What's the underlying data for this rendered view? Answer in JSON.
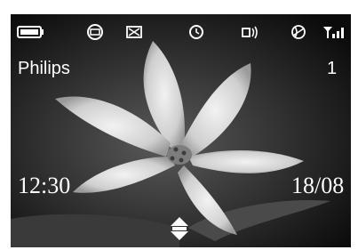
{
  "status_bar": {
    "icons": [
      "battery-icon",
      "message-icon",
      "missed-call-icon",
      "alarm-clock-icon",
      "ringer-volume-icon",
      "network-globe-icon",
      "signal-strength-icon"
    ]
  },
  "home": {
    "operator_name": "Philips",
    "line_number": "1",
    "time": "12:30",
    "date": "18/08"
  },
  "wallpaper": {
    "subject": "lily-flower",
    "colors": {
      "background": "#000000",
      "petal": "#e6e6e6",
      "foreground": "#ffffff"
    }
  },
  "navigation": {
    "icon": "up-down-navigation-icon"
  }
}
